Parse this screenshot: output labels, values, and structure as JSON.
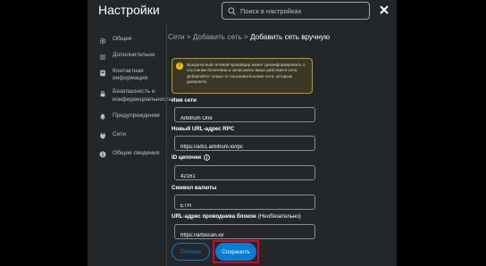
{
  "header": {
    "title": "Настройки",
    "search_placeholder": "Поиск в настройках"
  },
  "sidebar": {
    "items": [
      {
        "label": "Общее",
        "icon": "gear-icon"
      },
      {
        "label": "Дополнительно",
        "icon": "sliders-icon"
      },
      {
        "label": "Контактная информация",
        "icon": "book-icon"
      },
      {
        "label": "Безопасность и конфиденциальность",
        "icon": "lock-icon"
      },
      {
        "label": "Предупреждения",
        "icon": "bell-icon"
      },
      {
        "label": "Сети",
        "icon": "plug-icon"
      },
      {
        "label": "Общие сведения",
        "icon": "info-icon"
      }
    ]
  },
  "breadcrumb": {
    "part1": "Сети",
    "sep": ">",
    "part2": "Добавить сеть",
    "part3": "Добавить сеть вручную"
  },
  "warning": {
    "text": "Вредоносный сетевой провайдер может дезинформировать о состоянии блокчейна и записывать ваши действия в сети. Добавляйте только те пользовательские сети, которым доверяете."
  },
  "form": {
    "network_name_label": "Имя сети",
    "network_name_value": "Arbitrum One",
    "rpc_label": "Новый URL-адрес RPC",
    "rpc_value": "https://arb1.arbitrum.io/rpc",
    "chain_id_label": "ID цепочки",
    "chain_id_value": "42161",
    "symbol_label": "Символ валюты",
    "symbol_value": "ETH",
    "explorer_label": "URL-адрес проводника блоков",
    "explorer_optional": "(Необязательно)",
    "explorer_value": "https://arbiscan.io/"
  },
  "buttons": {
    "cancel": "Отмена",
    "save": "Сохранить"
  },
  "colors": {
    "panel_bg": "#24272a",
    "accent_blue": "#037dd6",
    "warning_border": "#c09a27",
    "highlight_red": "#e8001c"
  }
}
